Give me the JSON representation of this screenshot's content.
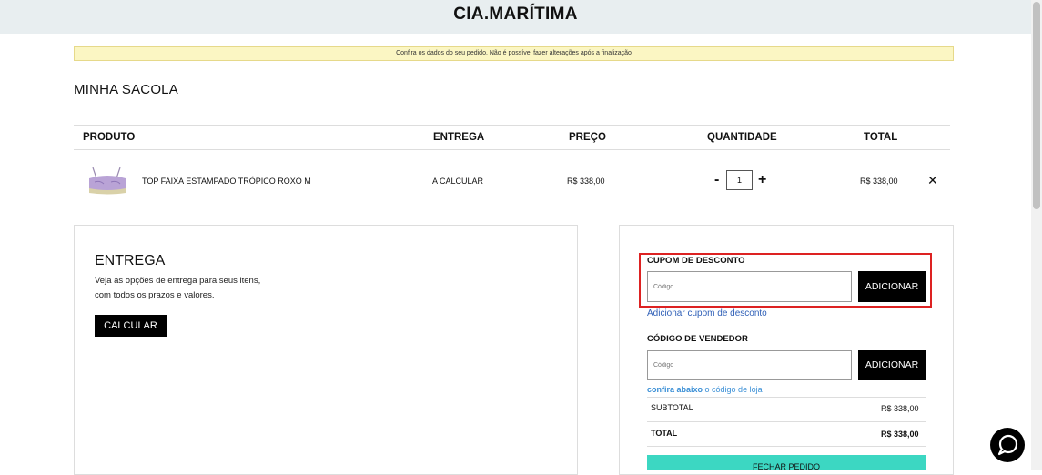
{
  "header": {
    "logo": "CIA.MARÍTIMA"
  },
  "notice": "Confira os dados do seu pedido. Não é possível fazer alterações após a finalização",
  "bag": {
    "title": "MINHA SACOLA",
    "columns": {
      "product": "PRODUTO",
      "delivery": "ENTREGA",
      "price": "PREÇO",
      "quantity": "QUANTIDADE",
      "total": "TOTAL"
    },
    "item": {
      "name": "TOP FAIXA ESTAMPADO TRÓPICO ROXO M",
      "delivery": "A CALCULAR",
      "price": "R$ 338,00",
      "quantity": "1",
      "total": "R$ 338,00",
      "minus": "-",
      "plus": "+",
      "remove": "✕"
    }
  },
  "shipping": {
    "title": "ENTREGA",
    "desc_line1": "Veja as opções de entrega para seus itens,",
    "desc_line2": "com todos os prazos e valores.",
    "button": "CALCULAR"
  },
  "coupon": {
    "title": "CUPOM DE DESCONTO",
    "placeholder": "Código",
    "button": "ADICIONAR",
    "link": "Adicionar cupom de desconto"
  },
  "seller": {
    "title": "CÓDIGO DE VENDEDOR",
    "placeholder": "Código",
    "button": "ADICIONAR",
    "hint_bold": "confira abaixo",
    "hint_rest": " o código de loja"
  },
  "summary": {
    "subtotal_label": "SUBTOTAL",
    "subtotal_value": "R$ 338,00",
    "total_label": "TOTAL",
    "total_value": "R$ 338,00",
    "checkout": "FECHAR PEDIDO"
  },
  "colors": {
    "accent": "#3cd7c2",
    "highlight": "#dd2222",
    "notice_bg": "#fbf6c3"
  },
  "icons": {
    "chat": "chat-bubble-icon",
    "remove": "close-icon"
  }
}
